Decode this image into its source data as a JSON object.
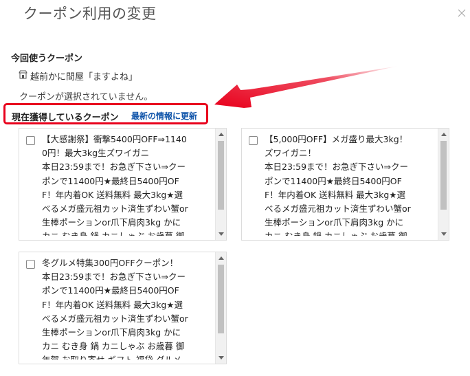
{
  "dialog": {
    "title": "クーポン利用の変更",
    "close_icon": "close-icon"
  },
  "current": {
    "section_label": "今回使うクーポン",
    "shop_icon": "shop-icon",
    "shop_name": "越前かに問屋「ますよね」",
    "no_coupon_text": "クーポンが選択されていません。"
  },
  "owned": {
    "label": "現在獲得しているクーポン",
    "refresh_link": "最新の情報に更新"
  },
  "highlight": {
    "color": "#e8001c"
  },
  "coupons": [
    {
      "checked": false,
      "text": "【大感謝祭】衝撃5400円OFF⇒1140\n0円！最大3kg生ズワイガニ\n本日23:59まで！お急ぎ下さい⇒クー\nポンで11400円★最終日5400円OF\nF！年内着OK 送料無料 最大3kg★選\nべるメガ盛元祖カット済生ずわい蟹or\n生棒ポーションor爪下肩肉3kg かに\nカニ むき身 鍋 カニしゃぶ お歳暮 御\n年賀 お取り寄せ ギフト 福袋 グルメ"
    },
    {
      "checked": false,
      "text": "【5,000円OFF】メガ盛り最大3kg！\nズワイガニ！\n本日23:59まで！お急ぎ下さい⇒クー\nポンで11400円★最終日5400円OF\nF！年内着OK 送料無料 最大3kg★選\nべるメガ盛元祖カット済生ずわい蟹or\n生棒ポーションor爪下肩肉3kg かに\nカニ むき身 鍋 カニしゃぶ お歳暮 御\n年賀 お取り寄せ ギフト 福袋 グルメ"
    },
    {
      "checked": false,
      "text": "冬グルメ特集300円OFFクーポン！\n本日23:59まで！お急ぎ下さい⇒クー\nポンで11400円★最終日5400円OF\nF！年内着OK 送料無料 最大3kg★選\nべるメガ盛元祖カット済生ずわい蟹or\n生棒ポーションor爪下肩肉3kg かに\nカニ むき身 鍋 カニしゃぶ お歳暮 御\n年賀 お取り寄せ ギフト 福袋 グルメ"
    }
  ]
}
